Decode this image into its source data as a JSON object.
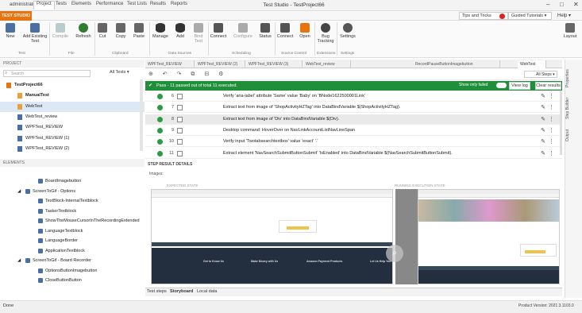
{
  "window": {
    "user": "administrator",
    "title": "Test Studio - TestProject66",
    "controls": [
      "–",
      "□",
      "✕"
    ]
  },
  "menubar": {
    "logo": "TEST STUDIO",
    "items": [
      "Project",
      "Tests",
      "Elements",
      "Performance",
      "Test Lists",
      "Results",
      "Reports"
    ],
    "tips": "Tips and Tricks",
    "guided": "Guided Tutorials",
    "help": "Help"
  },
  "ribbon": {
    "buttons": [
      {
        "label": "New",
        "icon": "new-icon",
        "color": "#4a6fa5"
      },
      {
        "label": "Add Existing Test",
        "icon": "add-existing-icon",
        "color": "#4a6fa5"
      },
      {
        "label": "Compile",
        "icon": "compile-icon",
        "color": "#9aa"
      },
      {
        "label": "Refresh",
        "icon": "refresh-icon",
        "color": "#2e7d32"
      },
      {
        "label": "Cut",
        "icon": "cut-icon",
        "color": "#555"
      },
      {
        "label": "Copy",
        "icon": "copy-icon",
        "color": "#555"
      },
      {
        "label": "Paste",
        "icon": "paste-icon",
        "color": "#555"
      },
      {
        "label": "Manage",
        "icon": "manage-icon",
        "color": "#333"
      },
      {
        "label": "Add",
        "icon": "add-icon",
        "color": "#333"
      },
      {
        "label": "Bind Test",
        "icon": "bind-icon",
        "color": "#999"
      },
      {
        "label": "Connect",
        "icon": "connect-icon",
        "color": "#444"
      },
      {
        "label": "Configure",
        "icon": "configure-icon",
        "color": "#888"
      },
      {
        "label": "Status",
        "icon": "status-icon",
        "color": "#444"
      },
      {
        "label": "Connect",
        "icon": "source-connect-icon",
        "color": "#444"
      },
      {
        "label": "Open",
        "icon": "open-icon",
        "color": "#e8740f"
      },
      {
        "label": "Bug Tracking",
        "icon": "bug-icon",
        "color": "#444"
      },
      {
        "label": "Settings",
        "icon": "settings-icon",
        "color": "#555"
      },
      {
        "label": "Layout",
        "icon": "layout-icon",
        "color": "#555"
      }
    ],
    "groups": [
      "Test",
      "File",
      "Clipboard",
      "Data Sources",
      "Scheduling",
      "Source Control",
      "Extensions",
      "Settings"
    ]
  },
  "project": {
    "header": "PROJECT",
    "search_placeholder": "Search",
    "filter": "All Tests",
    "tree": [
      {
        "label": "TestProject66",
        "bold": true,
        "indent": 8,
        "icon_color": "#e8740f"
      },
      {
        "label": "ManualTest",
        "bold": true,
        "indent": 22,
        "icon_color": "#e8a23a"
      },
      {
        "label": "WebTest",
        "bold": false,
        "indent": 22,
        "icon_color": "#e8a23a",
        "selected": true
      },
      {
        "label": "WebTest_review",
        "bold": false,
        "indent": 22,
        "icon_color": "#4a6fa5"
      },
      {
        "label": "WPFTest_REVIEW",
        "bold": false,
        "indent": 22,
        "icon_color": "#4a6fa5"
      },
      {
        "label": "WPFTest_REVIEW (1)",
        "bold": false,
        "indent": 22,
        "icon_color": "#4a6fa5"
      },
      {
        "label": "WPFTest_REVIEW (2)",
        "bold": false,
        "indent": 22,
        "icon_color": "#4a6fa5"
      }
    ]
  },
  "elements": {
    "header": "ELEMENTS",
    "items": [
      {
        "label": "BoardImagebutton",
        "indent": 48
      },
      {
        "label": "ScreenToGif - Options",
        "indent": 32
      },
      {
        "label": "TextBlock-InternalTextblock",
        "indent": 48
      },
      {
        "label": "TaskerTextblock",
        "indent": 48
      },
      {
        "label": "ShowTheMouseCursorInTheRecordingExtended",
        "indent": 48
      },
      {
        "label": "LanguageTextblock",
        "indent": 48
      },
      {
        "label": "LanguageBorder",
        "indent": 48
      },
      {
        "label": "ApplicationTextblock",
        "indent": 48
      },
      {
        "label": "ScreenToGif - Board Recorder",
        "indent": 32
      },
      {
        "label": "OptionsButtonImagebutton",
        "indent": 48
      },
      {
        "label": "CloseButtonButton",
        "indent": 48
      }
    ]
  },
  "tabs": [
    "WPFTest_REVIEW",
    "WPFTest_REVIEW (2)",
    "WPFTest_REVIEW (3)",
    "WebTest_review",
    "RecordPauseButtonImagebutton",
    "WebTest"
  ],
  "content": {
    "steps_filter": "All Steps",
    "pass_message": "Pass - 11 passed out of total 11 executed.",
    "show_only_failed": "Show only failed",
    "view_log": "View log",
    "clear_results": "Clear results",
    "rows": [
      {
        "num": "6",
        "text": "Verify 'aria-label' attribute 'Same' value 'Baby' on 'BNode1622500001Link'"
      },
      {
        "num": "7",
        "text": "Extract text from image of 'ShopActivityHZTag' into DataBindVariable $(ShopActivityHZTag)."
      },
      {
        "num": "8",
        "text": "Extract text from image of 'Div' into DataBindVariable $(Div).",
        "selected": true
      },
      {
        "num": "9",
        "text": "Desktop command: HoverOver on NavLinkAccountListNavLineSpan"
      },
      {
        "num": "10",
        "text": "Verify input 'Twotabsearchtextbox' value 'exact' '.'"
      },
      {
        "num": "11",
        "text": "Extract element 'NavSearchSubmitButtonSubmit' 'IsEnabled' into DataBindVariable $(NavSearchSubmitButtonSubmit)."
      }
    ],
    "step_result": "STEP RESULT DETAILS",
    "images": "Images:",
    "expected": "EXPECTED STATE",
    "running": "RUNNING EXECUTION STATE"
  },
  "bottom_tabs": [
    "Test steps",
    "Storyboard",
    "Local data"
  ],
  "side_tabs": [
    "Properties",
    "Step Builder",
    "Output"
  ],
  "status": {
    "left": "Done",
    "version": "Product Version: 2021.3.1103.0"
  }
}
